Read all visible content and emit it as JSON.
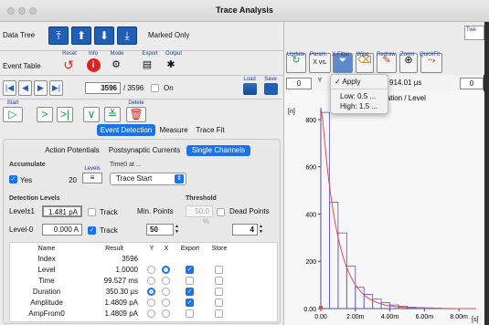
{
  "window": {
    "title": "Trace Analysis"
  },
  "top": {
    "data_tree_label": "Data Tree",
    "marked_only_label": "Marked Only",
    "right_partial": "Twe"
  },
  "event_table": {
    "label": "Event Table",
    "buttons": [
      {
        "name": "reset",
        "label": "Reset",
        "icon": "↺"
      },
      {
        "name": "info",
        "label": "Info",
        "icon": "i"
      },
      {
        "name": "mode",
        "label": "Mode",
        "icon": "⚙"
      },
      {
        "name": "export",
        "label": "Export",
        "icon": "▤"
      },
      {
        "name": "output",
        "label": "Output",
        "icon": "✱"
      }
    ]
  },
  "nav": {
    "current": "3596",
    "total": "/ 3596",
    "on_label": "On",
    "load_label": "Load",
    "save_label": "Save"
  },
  "actions": {
    "start_label": "Start",
    "delete_label": "Delete"
  },
  "tabs": [
    "Event Detection",
    "Measure",
    "Trace Fit"
  ],
  "subtabs": [
    "Action Potentials",
    "Postsynaptic Currents",
    "Single Channels"
  ],
  "accumulate": {
    "label": "Accumulate",
    "yes_label": "Yes",
    "count": "20",
    "levels_label": "Levels",
    "time0_label": "Time0 at ...",
    "time0_value": "Trace Start"
  },
  "detection": {
    "label": "Detection Levels",
    "threshold_label": "Threshold",
    "threshold_value": "50.0 %",
    "level1_label": "Level±1",
    "level1_value": "1.481 pA",
    "level0_label": "Level-0",
    "level0_value": "0.000 A",
    "track_label": "Track",
    "min_points_label": "Min. Points",
    "min_points_value": "50",
    "dead_points_label": "Dead Points",
    "dead_points_value": "4"
  },
  "table": {
    "headers": [
      "Name",
      "Result",
      "Y",
      "X",
      "Export",
      "Store"
    ],
    "rows": [
      {
        "name": "Index",
        "result": "3596"
      },
      {
        "name": "Level",
        "result": "1.0000"
      },
      {
        "name": "Time",
        "result": "99.527 ms"
      },
      {
        "name": "Duration",
        "result": "350.30 µs"
      },
      {
        "name": "Amplitude",
        "result": "1.4809 pA"
      },
      {
        "name": "AmpFrom0",
        "result": "1.4809 pA"
      }
    ]
  },
  "graph_toolbar": {
    "buttons": [
      {
        "name": "update",
        "label": "Update",
        "icon": "↻"
      },
      {
        "name": "param",
        "label": "Param.",
        "icon": "X vs. Y"
      },
      {
        "name": "xfilter",
        "label": "X-Filter",
        "icon": "⏷"
      },
      {
        "name": "wipe",
        "label": "Wipe",
        "icon": "🧹"
      },
      {
        "name": "redraw",
        "label": "Redraw",
        "icon": "✎"
      },
      {
        "name": "zoom",
        "label": "Zoom",
        "icon": "⊕"
      },
      {
        "name": "quickfit",
        "label": "QuickFit",
        "icon": "⤳"
      }
    ],
    "left_value": "0",
    "mid_value": "τ ± 914.01 µs",
    "right_value": "0"
  },
  "filter_menu": {
    "apply": "Apply",
    "low": "Low: 0.5 ...",
    "high": "High: 1.5 ..."
  },
  "chart_data": {
    "type": "bar",
    "title": "...ation / Level",
    "ylabel": "[n]",
    "xlabel": "[s]",
    "ylim": [
      0,
      850
    ],
    "xlim": [
      0,
      0.009
    ],
    "yticks": [
      "0.00",
      "200",
      "400",
      "600",
      "800"
    ],
    "ytick_values": [
      0,
      200,
      400,
      600,
      800
    ],
    "xticks": [
      "0.00",
      "2.00m",
      "4.00m",
      "6.00m",
      "8.00m"
    ],
    "xtick_values": [
      0,
      0.002,
      0.004,
      0.006,
      0.008
    ],
    "bin_width": 0.0005,
    "bins_x": [
      0,
      0.0005,
      0.001,
      0.0015,
      0.002,
      0.0025,
      0.003,
      0.0035,
      0.004,
      0.0045,
      0.005,
      0.0055,
      0.006,
      0.0065
    ],
    "values": [
      830,
      450,
      320,
      180,
      90,
      60,
      40,
      25,
      15,
      10,
      6,
      4,
      3,
      2
    ],
    "fit": {
      "type": "exponential",
      "amplitude": 900,
      "tau": 0.00091401
    },
    "colors": {
      "bars": "#5b52c4",
      "fit": "#e5484d"
    }
  }
}
